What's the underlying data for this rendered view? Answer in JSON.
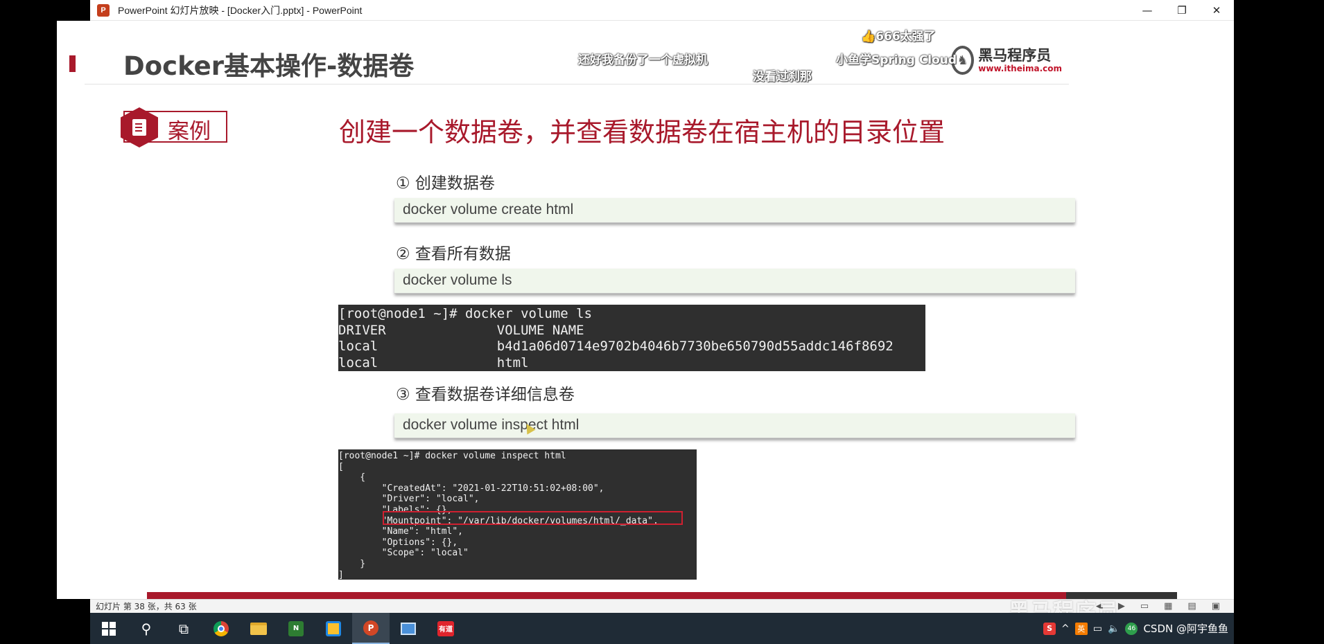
{
  "window": {
    "title": "PowerPoint 幻灯片放映 - [Docker入门.pptx] - PowerPoint",
    "app_icon_letter": "P",
    "minimize_icon": "—",
    "restore_icon": "❐",
    "close_icon": "✕"
  },
  "slide": {
    "title": "Docker基本操作-数据卷",
    "logo_cn": "黑马程序员",
    "logo_url": "www.itheima.com",
    "case_label": "案例",
    "case_heading": "创建一个数据卷，并查看数据卷在宿主机的目录位置",
    "steps": [
      {
        "label": "①  创建数据卷",
        "command": "docker volume create html"
      },
      {
        "label": "②  查看所有数据",
        "command": "docker volume ls"
      },
      {
        "label": "③  查看数据卷详细信息卷",
        "command": "docker volume inspect html"
      }
    ],
    "terminal_ls": [
      "[root@node1 ~]# docker volume ls",
      "DRIVER              VOLUME NAME",
      "local               b4d1a06d0714e9702b4046b7730be650790d55addc146f8692",
      "local               html"
    ],
    "terminal_inspect": [
      "[root@node1 ~]# docker volume inspect html",
      "[",
      "    {",
      "        \"CreatedAt\": \"2021-01-22T10:51:02+08:00\",",
      "        \"Driver\": \"local\",",
      "        \"Labels\": {},",
      "        \"Mountpoint\": \"/var/lib/docker/volumes/html/_data\",",
      "        \"Name\": \"html\",",
      "        \"Options\": {},",
      "        \"Scope\": \"local\"",
      "    }",
      "]"
    ]
  },
  "danmaku": [
    {
      "text": "👍666太强了"
    },
    {
      "text": "还好我备份了一个虚拟机"
    },
    {
      "text": "小鱼学Spring Cloud"
    },
    {
      "text": "没看过刹那"
    }
  ],
  "statusbar": {
    "slide_info": "幻灯片 第 38 张，共 63 张"
  },
  "watermark": "黑马程序员",
  "tray": {
    "csdn_label": "CSDN @阿宇鱼鱼",
    "lang": "英",
    "badge": "46"
  },
  "colors": {
    "accent_red": "#a8192b",
    "taskbar": "#1f2b36",
    "terminal_bg": "#2f2f2f",
    "command_bg": "#f0f6ec"
  }
}
